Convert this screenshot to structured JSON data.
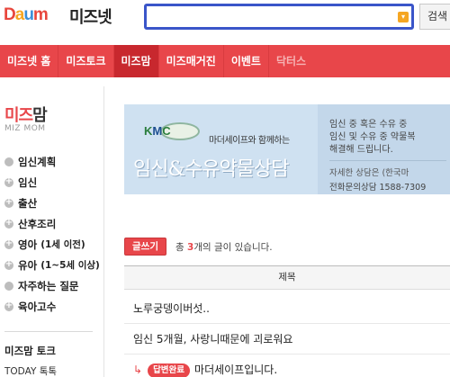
{
  "header": {
    "logo_parts": [
      "D",
      "a",
      "u",
      "m"
    ],
    "brand": "미즈넷",
    "search": {
      "placeholder": "",
      "button_label": "검색"
    }
  },
  "nav": {
    "items": [
      {
        "label": "미즈넷 홈"
      },
      {
        "label": "미즈토크"
      },
      {
        "label": "미즈맘"
      },
      {
        "label": "미즈매거진"
      },
      {
        "label": "이벤트"
      },
      {
        "label": "닥터스"
      }
    ],
    "active_index": 2
  },
  "sidebar": {
    "title_red": "미즈",
    "title_dark": "맘",
    "subtitle": "MIZ MOM",
    "items": [
      {
        "label": "임신계획",
        "icon": "dot-icon"
      },
      {
        "label": "임신",
        "icon": "plus-circle-icon"
      },
      {
        "label": "출산",
        "icon": "plus-circle-icon"
      },
      {
        "label": "산후조리",
        "icon": "plus-circle-icon"
      },
      {
        "label": "영아",
        "sub": "(1세 이전)",
        "icon": "plus-circle-icon"
      },
      {
        "label": "유아",
        "sub": "(1~5세 이상)",
        "icon": "plus-circle-icon"
      },
      {
        "label": "자주하는 질문",
        "icon": "dot-icon"
      },
      {
        "label": "육아고수",
        "icon": "plus-circle-icon"
      }
    ],
    "talk_title": "미즈맘 토크",
    "today_label": "TODAY 톡톡"
  },
  "banner": {
    "logo_k": "K",
    "logo_m": "M",
    "logo_c": "C",
    "with_text": "마더세이프와 함께하는",
    "headline": "임신&수유약물상담",
    "desc_lines": [
      "임신 중 혹은 수유 중",
      "임신 및 수유 중 약물복",
      "해결해 드립니다."
    ],
    "more_text": "자세한 상담은 (한국마",
    "phone_text": "전화문의상담 1588-7309"
  },
  "board": {
    "write_label": "글쓰기",
    "count_prefix": "총 ",
    "count_value": "3",
    "count_suffix": "개의 글이 있습니다.",
    "column_title": "제목",
    "posts": [
      {
        "title": "노루궁뎅이버섯.."
      },
      {
        "title": "임신 5개월, 사랑니때문에 괴로워요"
      },
      {
        "badge": "답변완료",
        "title": "마더세이프입니다."
      }
    ]
  },
  "colors": {
    "accent": "#e8464a",
    "active_nav": "#c8282e",
    "search_border": "#3a55c9"
  }
}
